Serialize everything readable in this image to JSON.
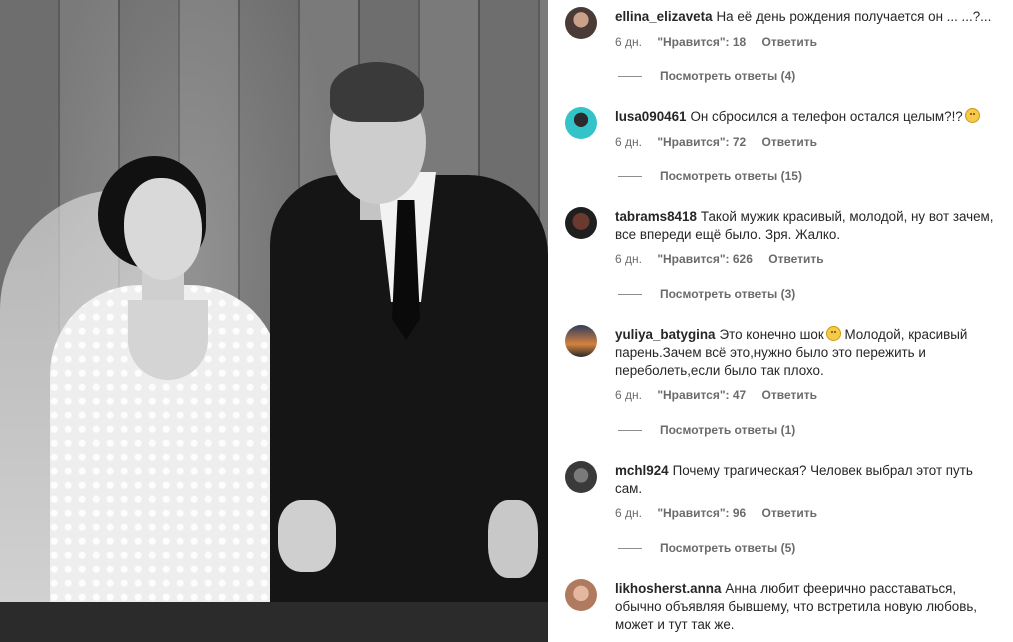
{
  "comments": [
    {
      "username": "ellina_elizaveta",
      "text": "На её день рождения получается он ... ...?...",
      "time": "6 дн.",
      "likes": "\"Нравится\": 18",
      "reply": "Ответить",
      "view_replies": "Посмотреть ответы (4)",
      "avatar_icon": "avatar-photo-woman"
    },
    {
      "username": "lusa090461",
      "text": "Он сбросился а телефон остался целым?!?",
      "emoji": "astonished-emoji",
      "time": "6 дн.",
      "likes": "\"Нравится\": 72",
      "reply": "Ответить",
      "view_replies": "Посмотреть ответы (15)",
      "avatar_icon": "avatar-photo-turquoise"
    },
    {
      "username": "tabrams8418",
      "text": "Такой мужик красивый, молодой, ну вот зачем, все впереди ещё было. Зря. Жалко.",
      "time": "6 дн.",
      "likes": "\"Нравится\": 626",
      "reply": "Ответить",
      "view_replies": "Посмотреть ответы (3)",
      "avatar_icon": "avatar-photo-dark"
    },
    {
      "username": "yuliya_batygina",
      "text_before_emoji": "Это конечно шок",
      "emoji": "disappointed-emoji",
      "text": "Молодой, красивый парень.Зачем всё это,нужно было это пережить и переболеть,если было так плохо.",
      "time": "6 дн.",
      "likes": "\"Нравится\": 47",
      "reply": "Ответить",
      "view_replies": "Посмотреть ответы (1)",
      "avatar_icon": "avatar-photo-sunset"
    },
    {
      "username": "mchl924",
      "text": "Почему трагическая? Человек выбрал этот путь сам.",
      "time": "6 дн.",
      "likes": "\"Нравится\": 96",
      "reply": "Ответить",
      "view_replies": "Посмотреть ответы (5)",
      "avatar_icon": "avatar-photo-man"
    },
    {
      "username": "likhosherst.anna",
      "text": "Анна любит феерично расставаться, обычно объявляя бывшему, что встретила новую любовь, может и тут так же.",
      "avatar_icon": "avatar-photo-woman-light"
    }
  ]
}
